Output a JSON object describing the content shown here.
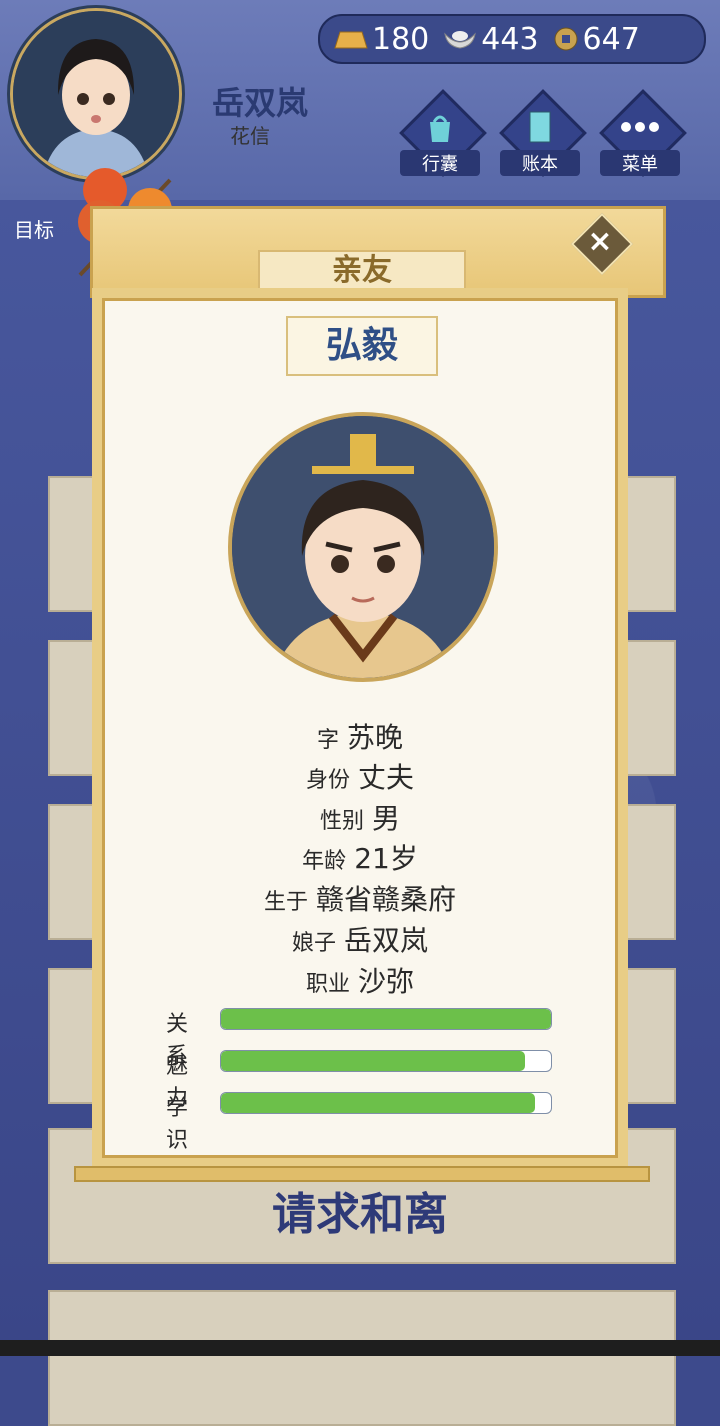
{
  "player": {
    "name": "岳双岚",
    "subtitle": "花信"
  },
  "currency": {
    "gold": "180",
    "silver": "443",
    "coin": "647"
  },
  "menu": [
    {
      "label": "行囊"
    },
    {
      "label": "账本"
    },
    {
      "label": "菜单"
    }
  ],
  "goal_label": "目标",
  "background_text": "请求和离",
  "panel": {
    "title": "亲友",
    "person_name": "弘毅",
    "info": [
      {
        "key": "字",
        "value": "苏晚"
      },
      {
        "key": "身份",
        "value": "丈夫"
      },
      {
        "key": "性别",
        "value": "男"
      },
      {
        "key": "年龄",
        "value": "21岁"
      },
      {
        "key": "生于",
        "value": "赣省赣桑府"
      },
      {
        "key": "娘子",
        "value": "岳双岚"
      },
      {
        "key": "职业",
        "value": "沙弥"
      }
    ],
    "bars": [
      {
        "label": "关系",
        "value": 1.0
      },
      {
        "label": "魅力",
        "value": 0.92
      },
      {
        "label": "学识",
        "value": 0.95
      }
    ]
  },
  "colors": {
    "bar_fill": "#6cc04a",
    "panel_gold": "#e8cd86",
    "name_blue": "#2f4f86"
  }
}
